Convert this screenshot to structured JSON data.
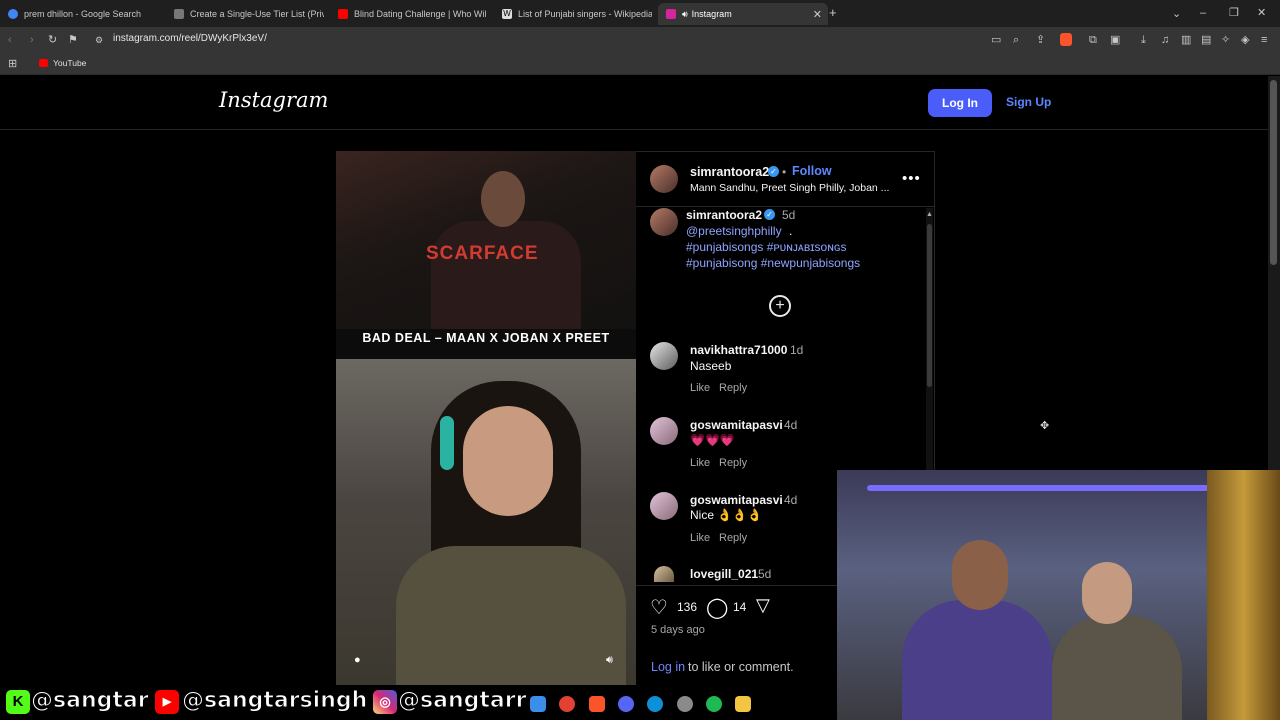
{
  "tabs": [
    {
      "title": "prem dhillon - Google Search",
      "color": "#4285f4"
    },
    {
      "title": "Create a Single-Use Tier List (Private",
      "color": "#555555"
    },
    {
      "title": "Blind Dating Challenge | Who Will K",
      "color": "#ff0000"
    },
    {
      "title": "List of Punjabi singers - Wikipedia",
      "color": "#dddddd"
    },
    {
      "title": "Instagram",
      "color": "#d6249f"
    }
  ],
  "toolbar": {
    "url": "instagram.com/reel/DWyKrPlx3eV/"
  },
  "bookmarks": [
    {
      "label": "YouTube"
    }
  ],
  "header": {
    "logo": "Instagram",
    "login": "Log In",
    "signup": "Sign Up"
  },
  "video": {
    "caption": "BAD DEAL – MAAN X JOBAN X PREET",
    "shirt_text": "SCARFACE"
  },
  "post": {
    "username": "simrantoora2",
    "follow": "Follow",
    "dot": "•",
    "subtitle": "Mann Sandhu, Preet Singh Philly, Joban ...",
    "caption_user": "simrantoora2",
    "caption_age": "5d",
    "mention": "@preetsinghphilly",
    "mention_suffix": ".",
    "hashtags_line1": "#punjabisongs #ᴘᴜɴᴊᴀʙɪsᴏɴɢs",
    "hashtags_line2": "#punjabisong #newpunjabisongs",
    "likes": "136",
    "comments_count": "14",
    "time_ago": "5 days ago",
    "login_link": "Log in",
    "login_suffix": "to like or comment."
  },
  "comments": [
    {
      "user": "navikhattra71000",
      "age": "1d",
      "text": "Naseeb",
      "like": "Like",
      "reply": "Reply"
    },
    {
      "user": "goswamitapasvi",
      "age": "4d",
      "text": "💗💗💗",
      "like": "Like",
      "reply": "Reply"
    },
    {
      "user": "goswamitapasvi",
      "age": "4d",
      "text": "Nice 👌👌👌",
      "like": "Like",
      "reply": "Reply"
    },
    {
      "user": "lovegill_021",
      "age": "5d"
    }
  ],
  "overlay": {
    "handle1": "@sangtar",
    "handle2": "@sangtarsingh",
    "handle3": "@sangtarr",
    "kick_letter": "K"
  }
}
